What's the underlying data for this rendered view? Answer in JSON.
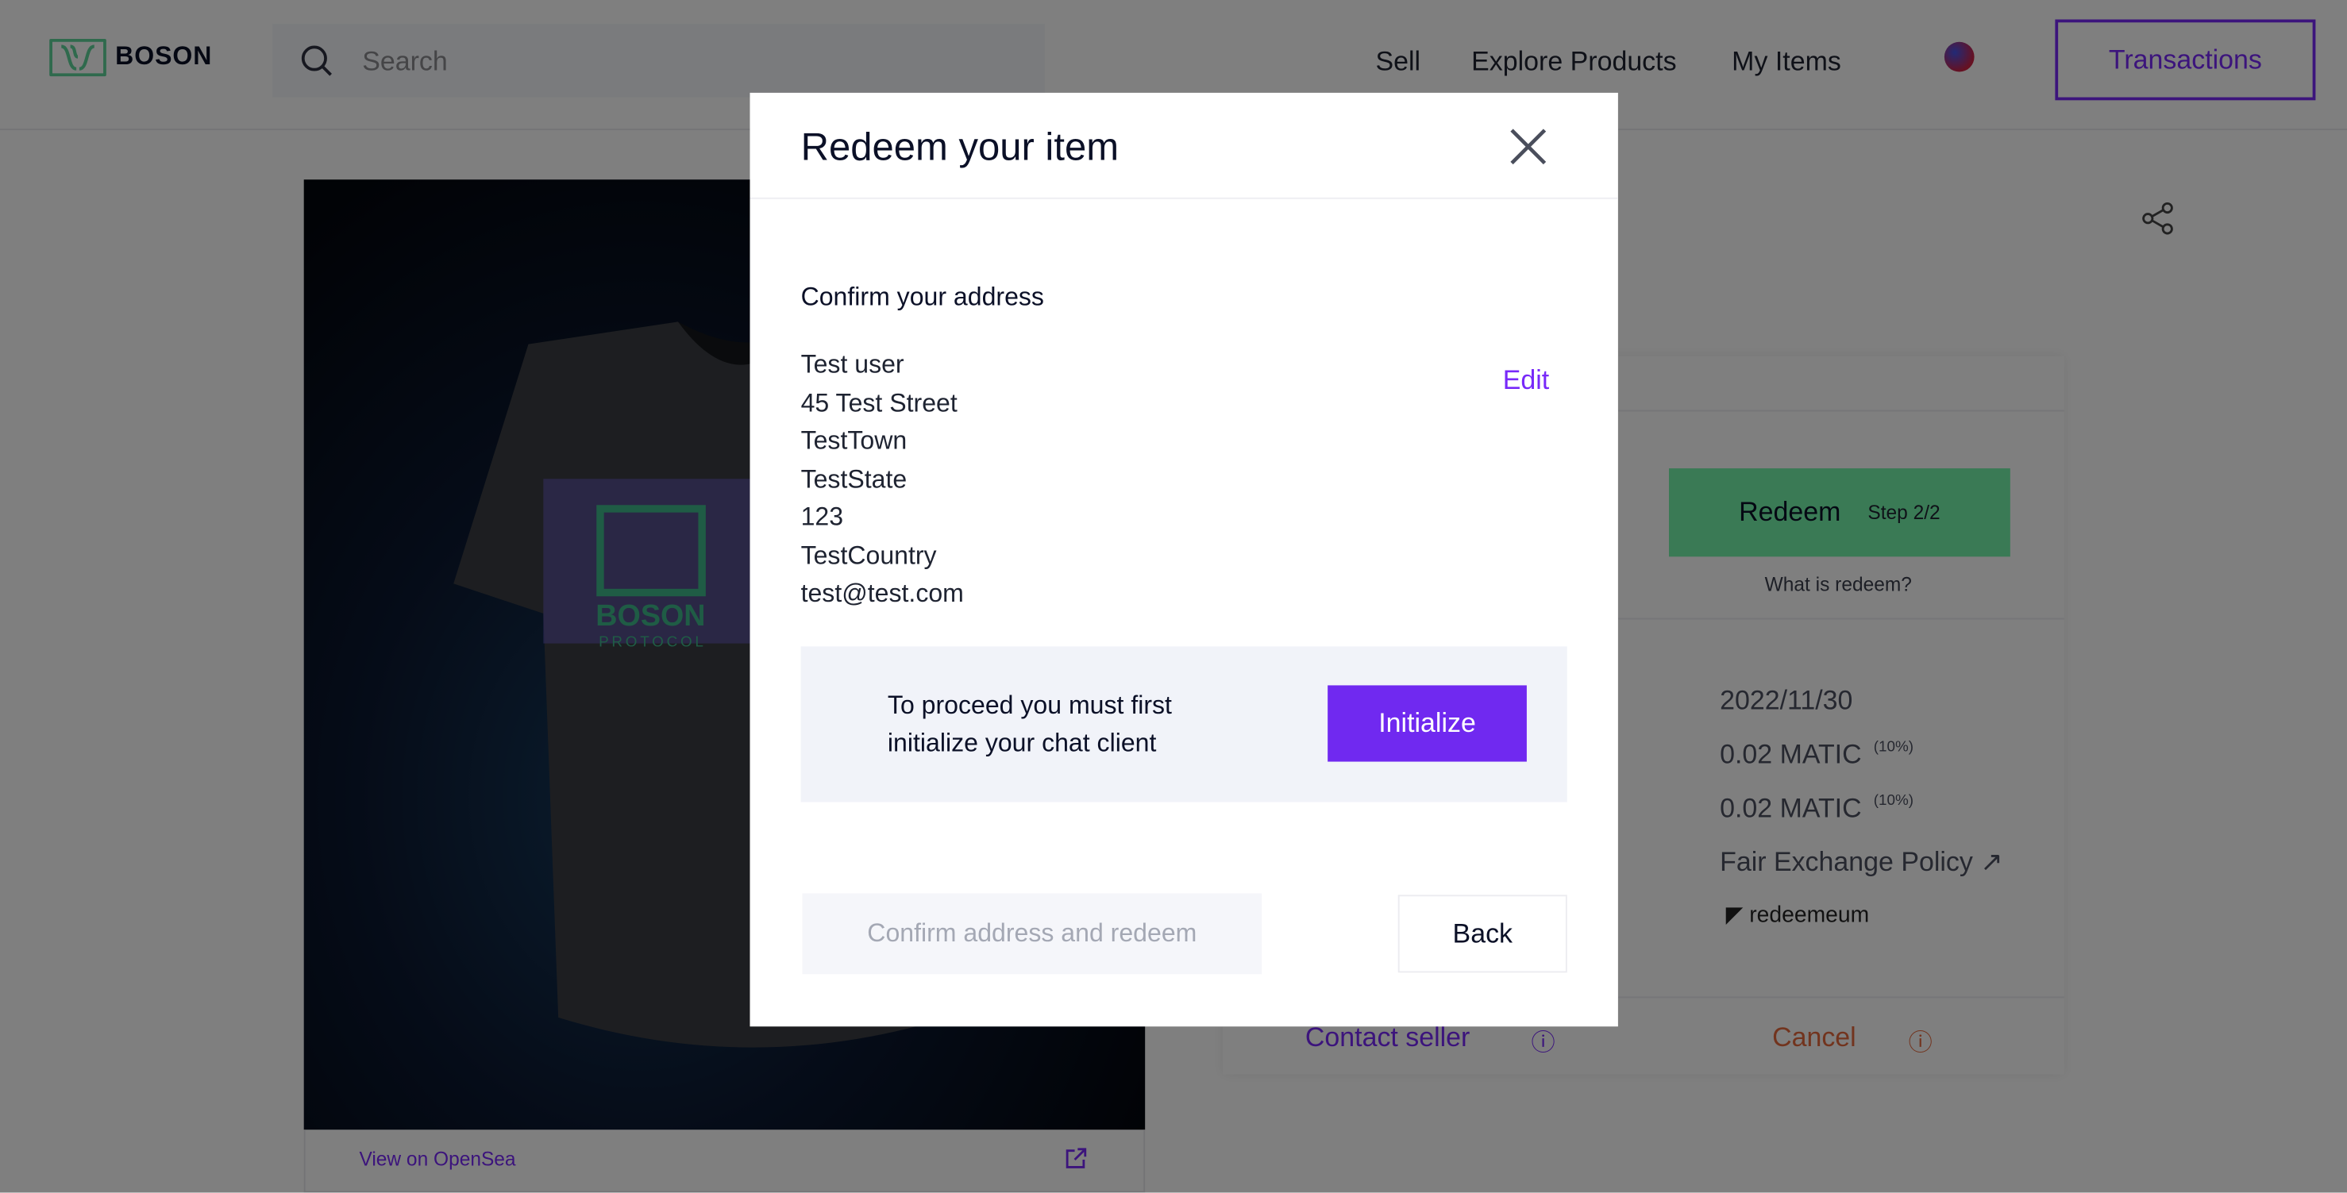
{
  "header": {
    "logo_text": "BOSON",
    "search_placeholder": "Search",
    "nav": [
      "Sell",
      "Explore Products",
      "My Items"
    ],
    "transactions_label": "Transactions"
  },
  "product": {
    "view_on_opensea": "View on OpenSea",
    "shirt_print": "BOSON",
    "shirt_print_sub": "PROTOCOL"
  },
  "card": {
    "redeem_label": "Redeem",
    "redeem_step": "Step 2/2",
    "what_is_redeem": "What is redeem?",
    "redeem_date": "2022/11/30",
    "price1": "0.02 MATIC",
    "price1_pct": "(10%)",
    "price2": "0.02 MATIC",
    "price2_pct": "(10%)",
    "policy": "Fair Exchange Policy",
    "redeemeum": "redeemeum",
    "contact_seller": "Contact seller",
    "cancel": "Cancel"
  },
  "modal": {
    "title": "Redeem your item",
    "confirm_heading": "Confirm your address",
    "address": [
      "Test user",
      "45 Test Street",
      "TestTown",
      "TestState",
      "123",
      "TestCountry",
      "test@test.com"
    ],
    "edit_label": "Edit",
    "info_text": "To proceed you must first initialize your chat client",
    "initialize_label": "Initialize",
    "confirm_button": "Confirm address and redeem",
    "back_button": "Back"
  },
  "colors": {
    "accent": "#7829f9",
    "green": "#74f4aa",
    "cancel": "#e4683c",
    "overlay": "rgba(0,0,0,0.5)"
  }
}
